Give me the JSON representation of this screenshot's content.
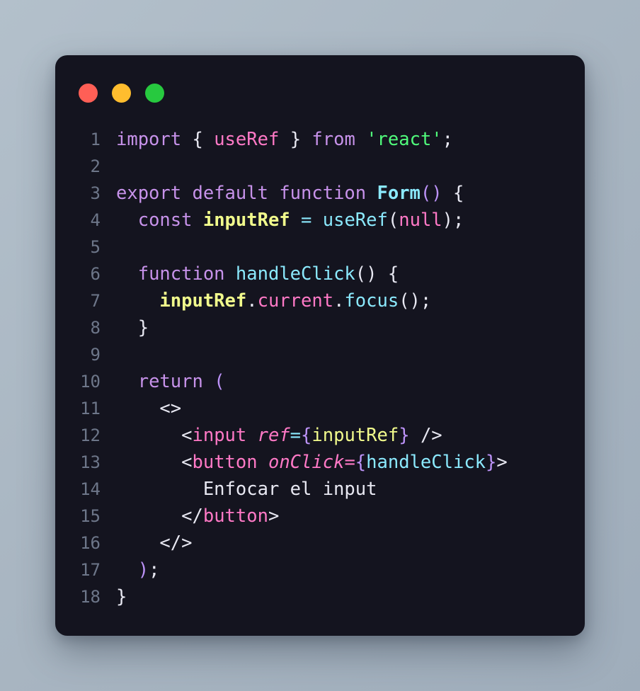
{
  "window": {
    "traffic_lights": [
      {
        "name": "close",
        "color": "#ff5f56"
      },
      {
        "name": "minimize",
        "color": "#ffbd2e"
      },
      {
        "name": "maximize",
        "color": "#27c93f"
      }
    ]
  },
  "editor": {
    "language": "jsx",
    "theme": "dracula",
    "background": "#14141f",
    "line_number_color": "#6d7689",
    "lines": [
      {
        "number": "1",
        "text": "import { useRef } from 'react';",
        "tokens": [
          {
            "t": "import",
            "c": "t-kw"
          },
          {
            "t": " ",
            "c": "t-plain"
          },
          {
            "t": "{",
            "c": "t-punct"
          },
          {
            "t": " ",
            "c": "t-plain"
          },
          {
            "t": "useRef",
            "c": "t-pink"
          },
          {
            "t": " ",
            "c": "t-plain"
          },
          {
            "t": "}",
            "c": "t-punct"
          },
          {
            "t": " ",
            "c": "t-plain"
          },
          {
            "t": "from",
            "c": "t-kw"
          },
          {
            "t": " ",
            "c": "t-plain"
          },
          {
            "t": "'react'",
            "c": "t-str"
          },
          {
            "t": ";",
            "c": "t-punct"
          }
        ]
      },
      {
        "number": "2",
        "text": "",
        "tokens": []
      },
      {
        "number": "3",
        "text": "export default function Form() {",
        "tokens": [
          {
            "t": "export",
            "c": "t-kw"
          },
          {
            "t": " ",
            "c": "t-plain"
          },
          {
            "t": "default",
            "c": "t-kw"
          },
          {
            "t": " ",
            "c": "t-plain"
          },
          {
            "t": "function",
            "c": "t-kw"
          },
          {
            "t": " ",
            "c": "t-plain"
          },
          {
            "t": "Form",
            "c": "t-fn"
          },
          {
            "t": "()",
            "c": "t-brace"
          },
          {
            "t": " ",
            "c": "t-plain"
          },
          {
            "t": "{",
            "c": "t-punct"
          }
        ]
      },
      {
        "number": "4",
        "text": "  const inputRef = useRef(null);",
        "tokens": [
          {
            "t": "  ",
            "c": "t-plain"
          },
          {
            "t": "const",
            "c": "t-kw"
          },
          {
            "t": " ",
            "c": "t-plain"
          },
          {
            "t": "inputRef",
            "c": "t-var"
          },
          {
            "t": " ",
            "c": "t-plain"
          },
          {
            "t": "=",
            "c": "t-op"
          },
          {
            "t": " ",
            "c": "t-plain"
          },
          {
            "t": "useRef",
            "c": "t-fncall"
          },
          {
            "t": "(",
            "c": "t-punct"
          },
          {
            "t": "null",
            "c": "t-pink"
          },
          {
            "t": ");",
            "c": "t-punct"
          }
        ]
      },
      {
        "number": "5",
        "text": "",
        "tokens": []
      },
      {
        "number": "6",
        "text": "  function handleClick() {",
        "tokens": [
          {
            "t": "  ",
            "c": "t-plain"
          },
          {
            "t": "function",
            "c": "t-kw"
          },
          {
            "t": " ",
            "c": "t-plain"
          },
          {
            "t": "handleClick",
            "c": "t-fncall"
          },
          {
            "t": "()",
            "c": "t-punct"
          },
          {
            "t": " ",
            "c": "t-plain"
          },
          {
            "t": "{",
            "c": "t-punct"
          }
        ]
      },
      {
        "number": "7",
        "text": "    inputRef.current.focus();",
        "tokens": [
          {
            "t": "    ",
            "c": "t-plain"
          },
          {
            "t": "inputRef",
            "c": "t-var"
          },
          {
            "t": ".",
            "c": "t-punct"
          },
          {
            "t": "current",
            "c": "t-pink"
          },
          {
            "t": ".",
            "c": "t-punct"
          },
          {
            "t": "focus",
            "c": "t-fncall"
          },
          {
            "t": "();",
            "c": "t-punct"
          }
        ]
      },
      {
        "number": "8",
        "text": "  }",
        "tokens": [
          {
            "t": "  ",
            "c": "t-plain"
          },
          {
            "t": "}",
            "c": "t-punct"
          }
        ]
      },
      {
        "number": "9",
        "text": "",
        "tokens": []
      },
      {
        "number": "10",
        "text": "  return (",
        "tokens": [
          {
            "t": "  ",
            "c": "t-plain"
          },
          {
            "t": "return",
            "c": "t-kw"
          },
          {
            "t": " ",
            "c": "t-plain"
          },
          {
            "t": "(",
            "c": "t-brace"
          }
        ]
      },
      {
        "number": "11",
        "text": "    <>",
        "tokens": [
          {
            "t": "    ",
            "c": "t-plain"
          },
          {
            "t": "<>",
            "c": "t-punct"
          }
        ]
      },
      {
        "number": "12",
        "text": "      <input ref={inputRef} />",
        "tokens": [
          {
            "t": "      ",
            "c": "t-plain"
          },
          {
            "t": "<",
            "c": "t-punct"
          },
          {
            "t": "input",
            "c": "t-pink"
          },
          {
            "t": " ",
            "c": "t-plain"
          },
          {
            "t": "ref",
            "c": "t-attr"
          },
          {
            "t": "=",
            "c": "t-op"
          },
          {
            "t": "{",
            "c": "t-brace"
          },
          {
            "t": "inputRef",
            "c": "t-varp"
          },
          {
            "t": "}",
            "c": "t-brace"
          },
          {
            "t": " ",
            "c": "t-plain"
          },
          {
            "t": "/>",
            "c": "t-punct"
          }
        ]
      },
      {
        "number": "13",
        "text": "      <button onClick={handleClick}>",
        "tokens": [
          {
            "t": "      ",
            "c": "t-plain"
          },
          {
            "t": "<",
            "c": "t-punct"
          },
          {
            "t": "button",
            "c": "t-pink"
          },
          {
            "t": " ",
            "c": "t-plain"
          },
          {
            "t": "onClick",
            "c": "t-attr"
          },
          {
            "t": "=",
            "c": "t-pink"
          },
          {
            "t": "{",
            "c": "t-brace"
          },
          {
            "t": "handleClick",
            "c": "t-fncall"
          },
          {
            "t": "}",
            "c": "t-brace"
          },
          {
            "t": ">",
            "c": "t-punct"
          }
        ]
      },
      {
        "number": "14",
        "text": "        Enfocar el input",
        "tokens": [
          {
            "t": "        ",
            "c": "t-plain"
          },
          {
            "t": "Enfocar el input",
            "c": "t-plain"
          }
        ]
      },
      {
        "number": "15",
        "text": "      </button>",
        "tokens": [
          {
            "t": "      ",
            "c": "t-plain"
          },
          {
            "t": "</",
            "c": "t-punct"
          },
          {
            "t": "button",
            "c": "t-pink"
          },
          {
            "t": ">",
            "c": "t-punct"
          }
        ]
      },
      {
        "number": "16",
        "text": "    </>",
        "tokens": [
          {
            "t": "    ",
            "c": "t-plain"
          },
          {
            "t": "</>",
            "c": "t-punct"
          }
        ]
      },
      {
        "number": "17",
        "text": "  );",
        "tokens": [
          {
            "t": "  ",
            "c": "t-plain"
          },
          {
            "t": ")",
            "c": "t-brace"
          },
          {
            "t": ";",
            "c": "t-punct"
          }
        ]
      },
      {
        "number": "18",
        "text": "}",
        "tokens": [
          {
            "t": "}",
            "c": "t-punct"
          }
        ]
      }
    ]
  }
}
